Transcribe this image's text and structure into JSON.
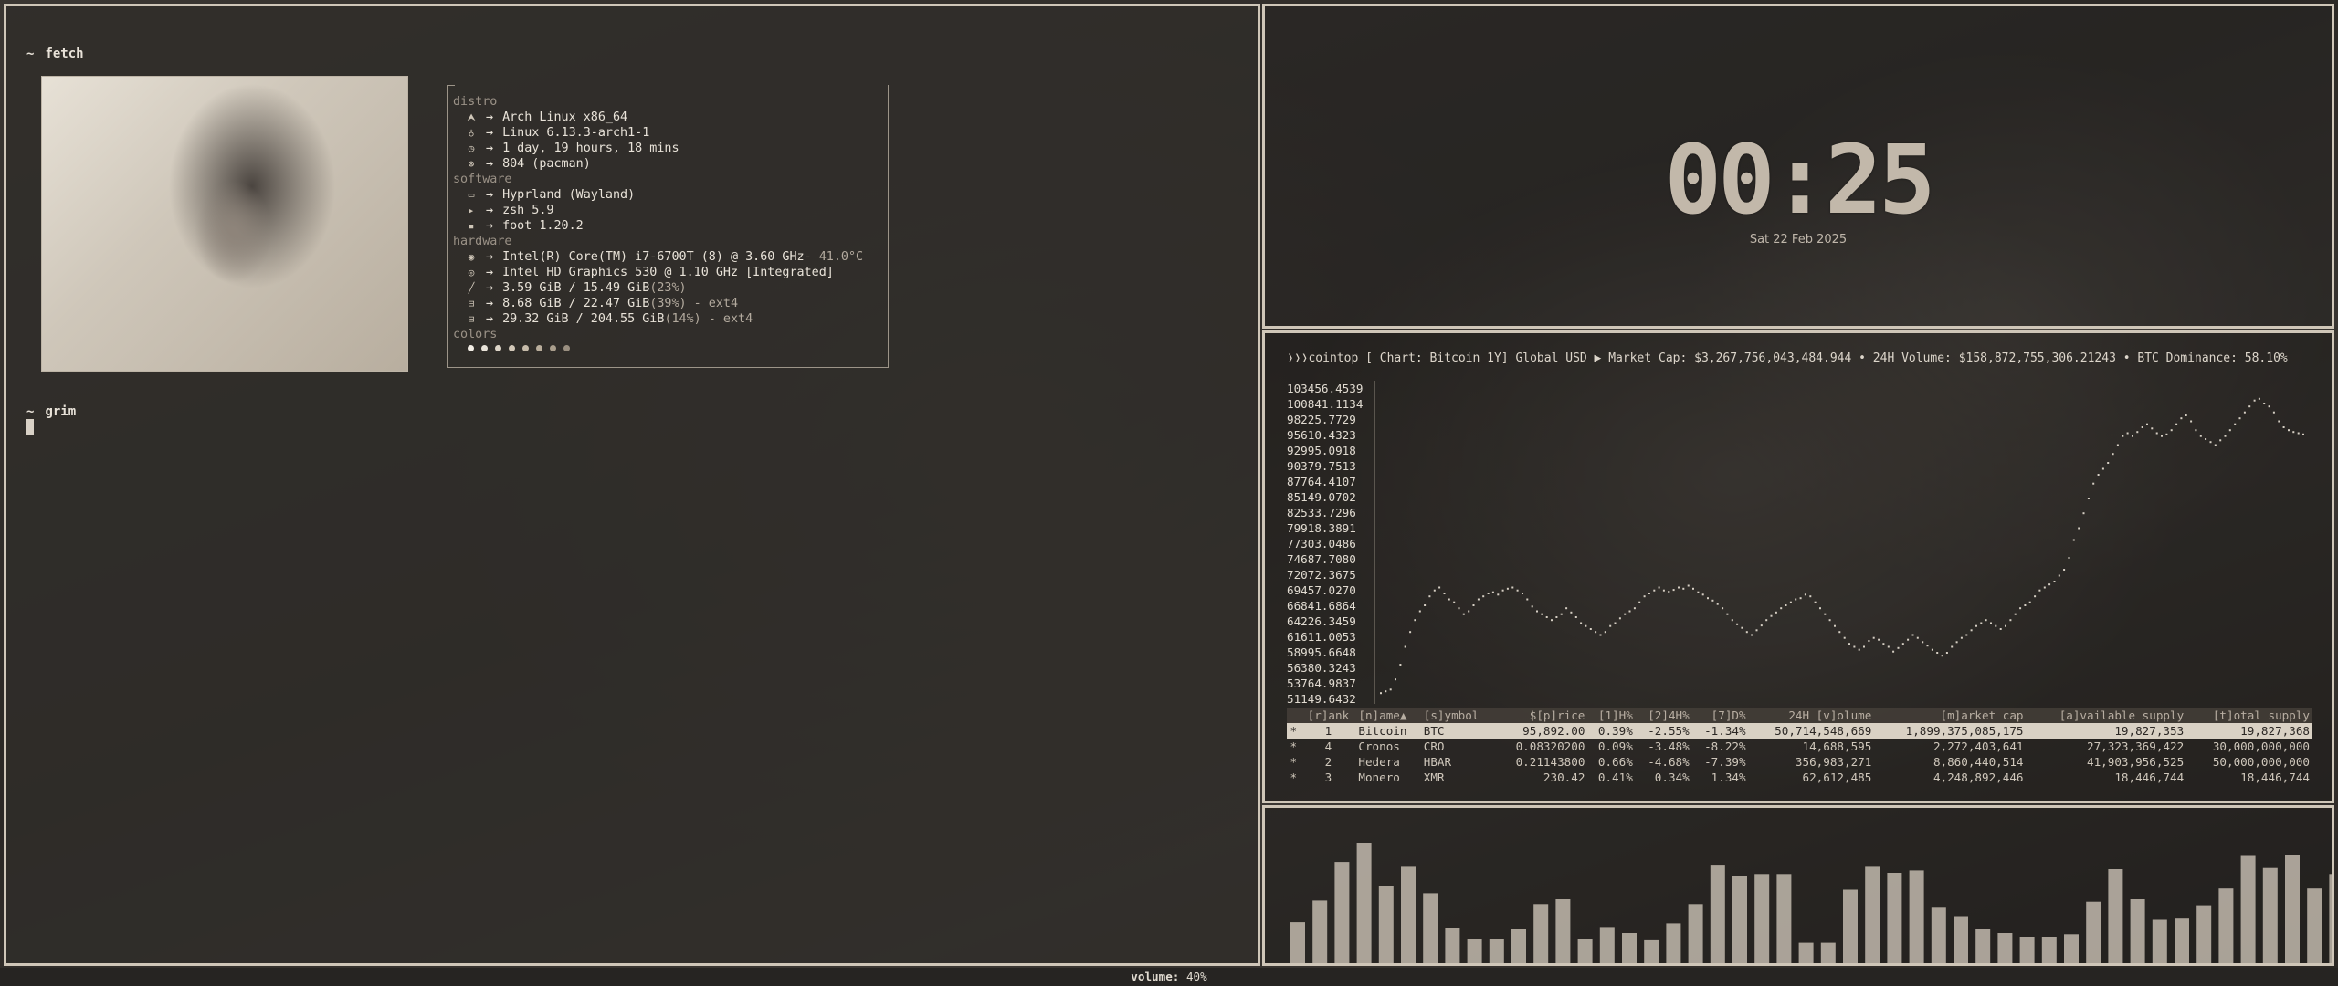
{
  "terminal": {
    "prompts": [
      {
        "tilde": "~",
        "command": "fetch"
      },
      {
        "tilde": "~",
        "command": "grim"
      }
    ],
    "fetch": {
      "sections": [
        {
          "title": "distro",
          "rows": [
            {
              "icon": "arch-icon",
              "glyph": "⮝",
              "text": "Arch Linux x86_64"
            },
            {
              "icon": "kernel-icon",
              "glyph": "♁",
              "text": "Linux 6.13.3-arch1-1"
            },
            {
              "icon": "clock-icon",
              "glyph": "◷",
              "text": "1 day, 19 hours, 18 mins"
            },
            {
              "icon": "package-icon",
              "glyph": "⊛",
              "text": "804 (pacman)"
            }
          ]
        },
        {
          "title": "software",
          "rows": [
            {
              "icon": "window-icon",
              "glyph": "▭",
              "text": "Hyprland (Wayland)"
            },
            {
              "icon": "shell-icon",
              "glyph": "▸",
              "text": "zsh 5.9"
            },
            {
              "icon": "terminal-icon",
              "glyph": "▪",
              "text": "foot 1.20.2"
            }
          ]
        },
        {
          "title": "hardware",
          "rows": [
            {
              "icon": "cpu-icon",
              "glyph": "◉",
              "text": "Intel(R) Core(TM) i7-6700T (8) @ 3.60 GHz",
              "extra": " - 41.0°C"
            },
            {
              "icon": "gpu-icon",
              "glyph": "◎",
              "text": "Intel HD Graphics 530 @ 1.10 GHz [Integrated]"
            },
            {
              "icon": "memory-icon",
              "glyph": "╱",
              "text": "3.59 GiB / 15.49 GiB",
              "extra": " (23%)"
            },
            {
              "icon": "swap-icon",
              "glyph": "⊟",
              "text": "8.68 GiB / 22.47 GiB",
              "extra": " (39%) - ext4"
            },
            {
              "icon": "disk-icon",
              "glyph": "⊟",
              "text": "29.32 GiB / 204.55 GiB",
              "extra": " (14%) - ext4"
            }
          ]
        }
      ],
      "colors_title": "colors",
      "palette": [
        "#f2ede5",
        "#e9e3d9",
        "#ddd5c8",
        "#d2c8b8",
        "#c6bba9",
        "#b9ad9b",
        "#aa9e8c",
        "#9a8f80"
      ],
      "arrow": "→"
    }
  },
  "clock": {
    "time": "00:25",
    "date": "Sat 22 Feb 2025"
  },
  "cointop": {
    "header": "❭❭❭cointop [ Chart: Bitcoin 1Y] Global USD ▶ Market Cap: $3,267,756,043,484.944 • 24H Volume: $158,872,755,306.21243 • BTC Dominance: 58.10%",
    "chart_data": {
      "type": "scatter",
      "title": "Chart: Bitcoin 1Y",
      "y_ticks": [
        "103456.4539",
        "100841.1134",
        "98225.7729",
        "95610.4323",
        "92995.0918",
        "90379.7513",
        "87764.4107",
        "85149.0702",
        "82533.7296",
        "79918.3891",
        "77303.0486",
        "74687.7080",
        "72072.3675",
        "69457.0270",
        "66841.6864",
        "64226.3459",
        "61611.0053",
        "58995.6648",
        "56380.3243",
        "53764.9837",
        "51149.6432"
      ],
      "ylim": [
        51149.6432,
        103456.4539
      ],
      "values": [
        52200,
        52500,
        52800,
        54500,
        57000,
        60000,
        62500,
        64500,
        66000,
        67000,
        68500,
        69500,
        70000,
        69000,
        68000,
        67500,
        66500,
        65500,
        66000,
        67000,
        68000,
        68500,
        69000,
        69200,
        68800,
        69500,
        69800,
        70000,
        69500,
        69000,
        68000,
        66800,
        66000,
        65500,
        65000,
        64500,
        65000,
        65500,
        66500,
        65800,
        65000,
        64000,
        63500,
        63000,
        62500,
        62000,
        62500,
        63500,
        64000,
        64800,
        65500,
        66000,
        66500,
        67500,
        68500,
        69000,
        69500,
        70000,
        69500,
        69300,
        69600,
        70000,
        69800,
        70300,
        69800,
        69200,
        68800,
        68200,
        67800,
        67200,
        66500,
        65500,
        64500,
        63800,
        63200,
        62500,
        62000,
        62800,
        63600,
        64500,
        65200,
        65800,
        66500,
        67000,
        67500,
        68000,
        68200,
        68800,
        68500,
        67500,
        66500,
        65500,
        64500,
        63500,
        62500,
        61500,
        60500,
        60000,
        59500,
        60000,
        61000,
        61500,
        61200,
        60500,
        60000,
        59200,
        59800,
        60500,
        61200,
        62000,
        61500,
        60800,
        60200,
        59500,
        59000,
        58500,
        59000,
        60000,
        60800,
        61500,
        62000,
        62800,
        63500,
        64000,
        64500,
        64000,
        63500,
        63000,
        63500,
        64500,
        65500,
        66500,
        67000,
        67500,
        68500,
        69500,
        70000,
        70500,
        71000,
        72000,
        73000,
        75000,
        78000,
        80000,
        82500,
        85000,
        87500,
        89000,
        90000,
        91000,
        92500,
        94000,
        95500,
        96000,
        95500,
        96200,
        97000,
        97500,
        96800,
        96000,
        95500,
        95800,
        96500,
        97500,
        98500,
        99000,
        98000,
        96500,
        95500,
        95000,
        94500,
        94000,
        94800,
        95500,
        96500,
        97500,
        98500,
        99500,
        100500,
        101500,
        101800,
        101000,
        100500,
        99500,
        98000,
        97000,
        96500,
        96200,
        96000,
        95800
      ]
    },
    "table": {
      "columns": [
        "[r]ank",
        "[n]ame▲",
        "[s]ymbol",
        "$[p]rice",
        "[1]H%",
        "[2]4H%",
        "[7]D%",
        "24H [v]olume",
        "[m]arket cap",
        "[a]vailable supply",
        "[t]otal supply"
      ],
      "rows": [
        {
          "star": "*",
          "rank": "1",
          "name": "Bitcoin",
          "symbol": "BTC",
          "price": "95,892.00",
          "h1": "0.39%",
          "h24": "-2.55%",
          "d7": "-1.34%",
          "volume": "50,714,548,669",
          "mcap": "1,899,375,085,175",
          "avail": "19,827,353",
          "total": "19,827,368"
        },
        {
          "star": "*",
          "rank": "4",
          "name": "Cronos",
          "symbol": "CRO",
          "price": "0.08320200",
          "h1": "0.09%",
          "h24": "-3.48%",
          "d7": "-8.22%",
          "volume": "14,688,595",
          "mcap": "2,272,403,641",
          "avail": "27,323,369,422",
          "total": "30,000,000,000"
        },
        {
          "star": "*",
          "rank": "2",
          "name": "Hedera",
          "symbol": "HBAR",
          "price": "0.21143800",
          "h1": "0.66%",
          "h24": "-4.68%",
          "d7": "-7.39%",
          "volume": "356,983,271",
          "mcap": "8,860,440,514",
          "avail": "41,903,956,525",
          "total": "50,000,000,000"
        },
        {
          "star": "*",
          "rank": "3",
          "name": "Monero",
          "symbol": "XMR",
          "price": "230.42",
          "h1": "0.41%",
          "h24": "0.34%",
          "d7": "1.34%",
          "volume": "62,612,485",
          "mcap": "4,248,892,446",
          "avail": "18,446,744",
          "total": "18,446,744"
        }
      ]
    }
  },
  "visualizer": {
    "levels": [
      0.34,
      0.52,
      0.84,
      1.0,
      0.64,
      0.8,
      0.58,
      0.29,
      0.2,
      0.2,
      0.28,
      0.49,
      0.53,
      0.2,
      0.3,
      0.25,
      0.19,
      0.33,
      0.49,
      0.81,
      0.72,
      0.74,
      0.74,
      0.17,
      0.17,
      0.61,
      0.8,
      0.75,
      0.77,
      0.46,
      0.39,
      0.28,
      0.25,
      0.22,
      0.22,
      0.24,
      0.51,
      0.78,
      0.53,
      0.36,
      0.37,
      0.48,
      0.62,
      0.89,
      0.79,
      0.9,
      0.62,
      0.74,
      0.67,
      0.86
    ]
  },
  "status": {
    "label": "volume:",
    "value": "40%"
  },
  "colors": {
    "border": "#cfc6b8",
    "accent": "#c2b8aa",
    "positive": "#cfc7bb",
    "negative": "#9e958a"
  }
}
